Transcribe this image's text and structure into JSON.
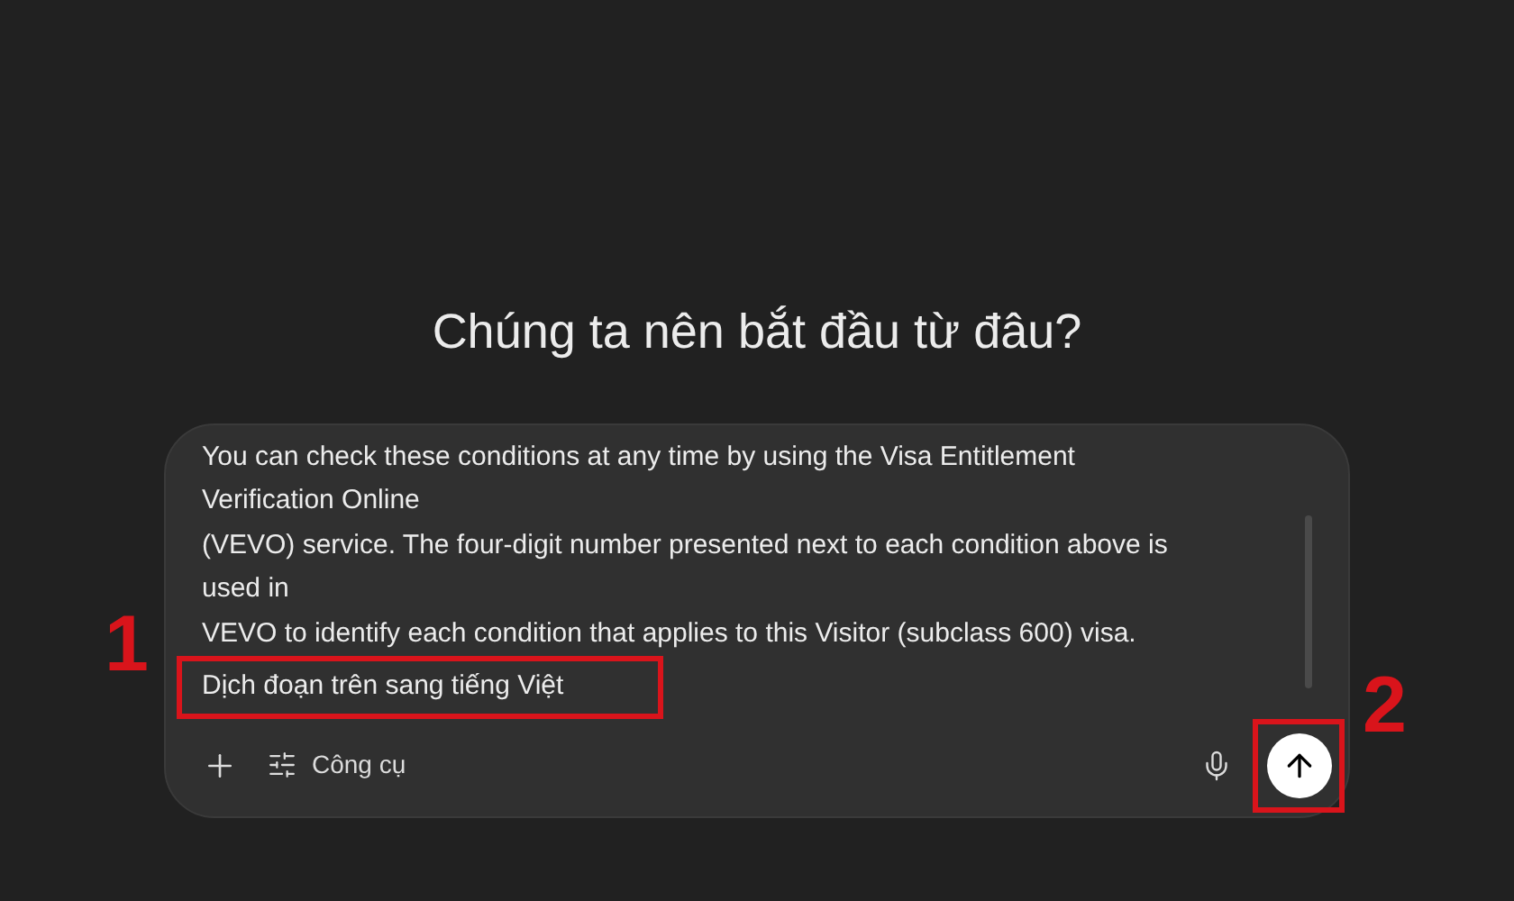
{
  "heading": "Chúng ta nên bắt đầu từ đâu?",
  "composer": {
    "lines": [
      "You can check these conditions at any time by using the Visa Entitlement",
      "Verification Online",
      "(VEVO) service. The four-digit number presented next to each condition above is",
      "used in",
      "VEVO to identify each condition that applies to this Visitor (subclass 600) visa.",
      "Dịch đoạn trên sang tiếng Việt"
    ],
    "tools_label": "Công cụ"
  },
  "annotations": [
    {
      "label": "1"
    },
    {
      "label": "2"
    }
  ]
}
